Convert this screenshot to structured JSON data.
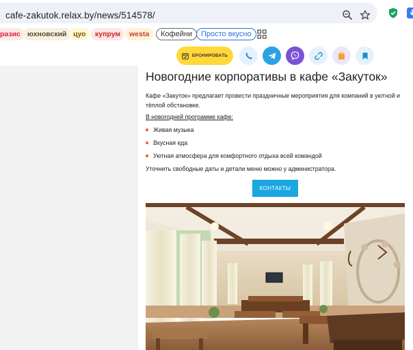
{
  "browser": {
    "url": "cafe-zakutok.relax.by/news/514578/",
    "bookmarks": [
      {
        "label": "разис",
        "bg": "#fde8e8",
        "fg": "#d4233a"
      },
      {
        "label": "юхновский",
        "bg": "#f7f1e3",
        "fg": "#5a4a2e"
      },
      {
        "label": "цуо",
        "bg": "#fff7d6",
        "fg": "#7a5a00"
      },
      {
        "label": "купрум",
        "bg": "#fde6e6",
        "fg": "#c62828"
      },
      {
        "label": "westa",
        "bg": "#fdf1d6",
        "fg": "#c4452e"
      },
      {
        "label": "Кофейни",
        "style": "outline",
        "border": "#666666",
        "fg": "#333333"
      },
      {
        "label": "Просто вкусно",
        "style": "outline",
        "border": "#2f6fd6",
        "fg": "#2f6fd6"
      }
    ]
  },
  "toolbar": {
    "book_label": "БРОНИРОВАТЬ",
    "icons": [
      "phone-icon",
      "telegram-icon",
      "viber-icon",
      "link-icon",
      "gift-icon",
      "bookmark-icon"
    ]
  },
  "article": {
    "title": "Новогодние корпоративы в кафе «Закуток»",
    "intro": "Кафе «Закуток» предлагает провести праздничные мероприятия для компаний в уютной и тёплой обстановке.",
    "program_label": "В новогодней программе кафе:",
    "bullets": [
      "Живая музыка",
      "Вкусная еда",
      "Уютная атмосфера для комфортного отдыха всей командой"
    ],
    "note": "Уточнить свободные даты и детали меню можно у администратора.",
    "contacts_button": "КОНТАКТЫ"
  },
  "colors": {
    "accent_blue": "#19a7e2",
    "book_yellow": "#ffd83a",
    "bullet_orange": "#f05a28"
  }
}
